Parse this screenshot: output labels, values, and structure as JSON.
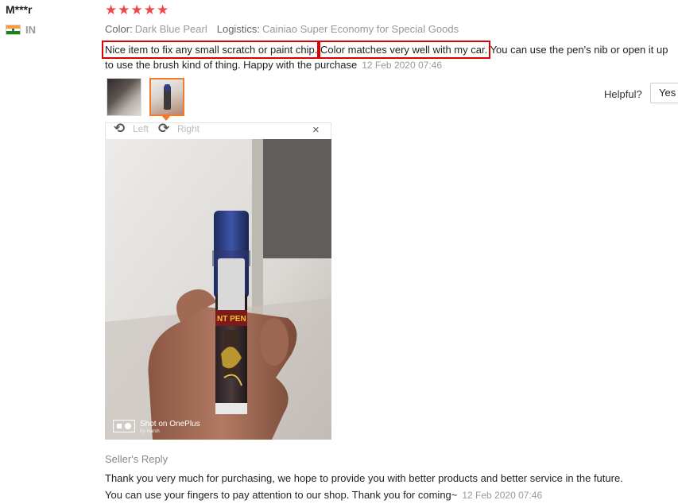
{
  "user": {
    "name": "M***r",
    "country": "IN"
  },
  "rating": {
    "stars": "★★★★★",
    "value": 5,
    "max": 5
  },
  "attributes": {
    "color_label": "Color:",
    "color_value": "Dark Blue Pearl",
    "logistics_label": "Logistics:",
    "logistics_value": "Cainiao Super Economy for Special Goods"
  },
  "review": {
    "part1": "Nice item to fix any small scratch or paint chip.",
    "part2": "Color matches very well with my car.",
    "part3": " You can use the pen's nib or open it up to use the brush kind of thing. Happy with the purchase",
    "date": "12 Feb 2020 07:46"
  },
  "helpful": {
    "label": "Helpful?",
    "yes": "Yes"
  },
  "viewer": {
    "rotate_left": "Left",
    "rotate_right": "Right",
    "close": "×"
  },
  "photo": {
    "pen_text": "NT PEN",
    "watermark": "Shot on OnePlus",
    "watermark_sub": "By Harsh"
  },
  "seller_reply": {
    "title": "Seller's Reply",
    "text": "Thank you very much for purchasing, we hope to provide you with better products and better service in the future. You can use your fingers to pay attention to our shop. Thank you for coming~",
    "date": "12 Feb 2020 07:46"
  },
  "colors": {
    "star": "#f04848",
    "highlight": "#e00000",
    "active_thumb": "#f07c2b"
  }
}
